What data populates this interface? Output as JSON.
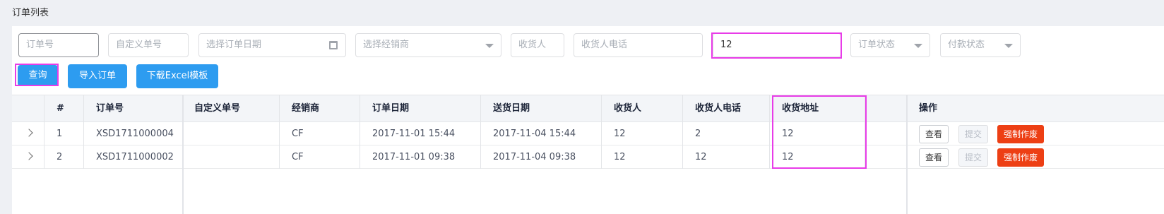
{
  "page": {
    "title": "订单列表"
  },
  "filters": {
    "order_no": {
      "placeholder": "订单号",
      "value": ""
    },
    "custom_no": {
      "placeholder": "自定义单号",
      "value": ""
    },
    "order_date": {
      "placeholder": "选择订单日期",
      "value": "",
      "icon": "calendar-icon"
    },
    "distributor": {
      "placeholder": "选择经销商",
      "value": ""
    },
    "consignee": {
      "placeholder": "收货人",
      "value": ""
    },
    "consignee_phone": {
      "placeholder": "收货人电话",
      "value": ""
    },
    "address": {
      "placeholder": "",
      "value": "12"
    },
    "order_status": {
      "placeholder": "订单状态",
      "value": ""
    },
    "payment_status": {
      "placeholder": "付款状态",
      "value": ""
    }
  },
  "toolbar": {
    "query_label": "查询",
    "import_label": "导入订单",
    "download_label": "下载Excel模板"
  },
  "table": {
    "columns": [
      "#",
      "订单号",
      "自定义单号",
      "经销商",
      "订单日期",
      "送货日期",
      "收货人",
      "收货人电话",
      "收货地址",
      "操作"
    ],
    "rows": [
      {
        "index": "1",
        "order_no": "XSD1711000004",
        "custom_no": "",
        "distributor": "CF",
        "order_date": "2017-11-01 15:44",
        "delivery_date": "2017-11-04 15:44",
        "consignee": "12",
        "phone": "2",
        "address": "12"
      },
      {
        "index": "2",
        "order_no": "XSD1711000002",
        "custom_no": "",
        "distributor": "CF",
        "order_date": "2017-11-01 09:38",
        "delivery_date": "2017-11-04 09:38",
        "consignee": "12",
        "phone": "12",
        "address": "12"
      }
    ],
    "actions": {
      "view": "查看",
      "submit": "提交",
      "void": "强制作废"
    }
  },
  "colors": {
    "primary": "#2d9cf0",
    "danger": "#ed3f14",
    "highlight": "#e83ce8"
  }
}
